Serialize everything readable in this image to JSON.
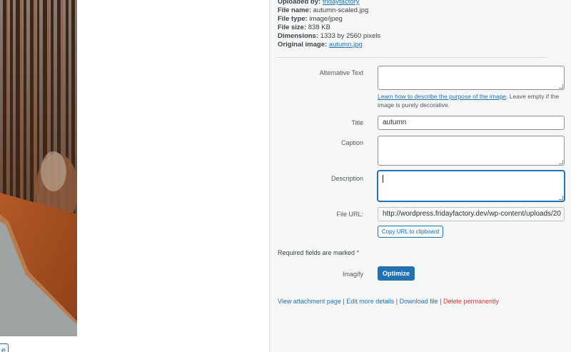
{
  "meta": {
    "uploaded_by_label": "Uploaded by:",
    "uploaded_by_value": "fridayfactory",
    "file_name_label": "File name:",
    "file_name_value": "autumn-scaled.jpg",
    "file_type_label": "File type:",
    "file_type_value": "image/jpeg",
    "file_size_label": "File size:",
    "file_size_value": "838 KB",
    "dimensions_label": "Dimensions:",
    "dimensions_value": "1333 by 2560 pixels",
    "original_label": "Original image:",
    "original_value": "autumn.jpg"
  },
  "form": {
    "alt_label": "Alternative Text",
    "alt_value": "",
    "alt_help_link": "Learn how to describe the purpose of the image",
    "alt_help_text": ". Leave empty if the image is purely decorative.",
    "title_label": "Title",
    "title_value": "autumn",
    "caption_label": "Caption",
    "caption_value": "",
    "description_label": "Description",
    "description_value": "",
    "file_url_label": "File URL:",
    "file_url_value": "http://wordpress.fridayfactory.dev/wp-content/uploads/20",
    "copy_url_label": "Copy URL to clipboard",
    "required_text": "Required fields are marked",
    "required_star": "*",
    "imagify_label": "Imagify",
    "optimize_label": "Optimize"
  },
  "actions": {
    "view": "View attachment page",
    "edit": "Edit more details",
    "download": "Download file",
    "delete": "Delete permanently",
    "separator": " | "
  },
  "left_button_label": "e",
  "colors": {
    "accent": "#2271b1",
    "danger": "#d63638",
    "panel_bg": "#f6f7f7"
  }
}
